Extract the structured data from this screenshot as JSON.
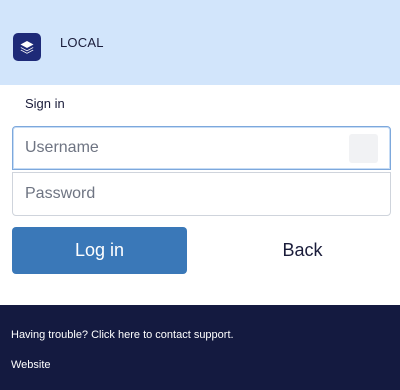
{
  "header": {
    "title": "LOCAL",
    "icon": "layers-icon",
    "background": "#d2e5fb",
    "icon_color": "#1e2a78"
  },
  "form": {
    "heading": "Sign in",
    "username_placeholder": "Username",
    "username_value": "",
    "password_placeholder": "Password",
    "password_value": "",
    "login_label": "Log in",
    "back_label": "Back",
    "accent": "#3a78b8"
  },
  "footer": {
    "support_text": "Having trouble? Click here to contact support.",
    "website_text": "Website",
    "background": "#141a40"
  }
}
